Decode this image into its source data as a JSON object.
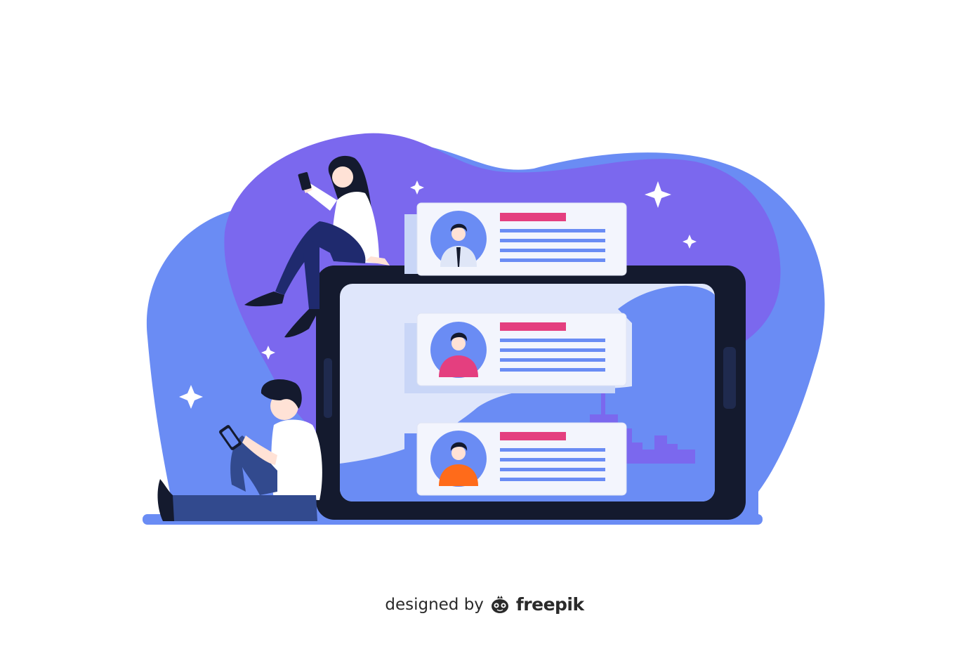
{
  "illustration": {
    "subject": "profile-cards-on-tablet",
    "colors": {
      "blob_purple": "#7b68ee",
      "blob_blue": "#6a8cf4",
      "tablet_frame": "#141a2e",
      "screen_bg": "#dfe6fb",
      "card_bg": "#f3f5fd",
      "card_title_bar": "#e43f7f",
      "card_line": "#6a8cf4",
      "avatar_bg": "#6a8cf4",
      "floor": "#6a8cf4"
    },
    "cards": [
      {
        "avatar_shirt": "#dfe6f7",
        "tie": true
      },
      {
        "avatar_shirt": "#e43f7f",
        "tie": false
      },
      {
        "avatar_shirt": "#ff6b1a",
        "tie": false
      }
    ]
  },
  "credit": {
    "prefix": "designed by",
    "brand": "freepik",
    "logo_icon": "freepik-logo-icon"
  }
}
